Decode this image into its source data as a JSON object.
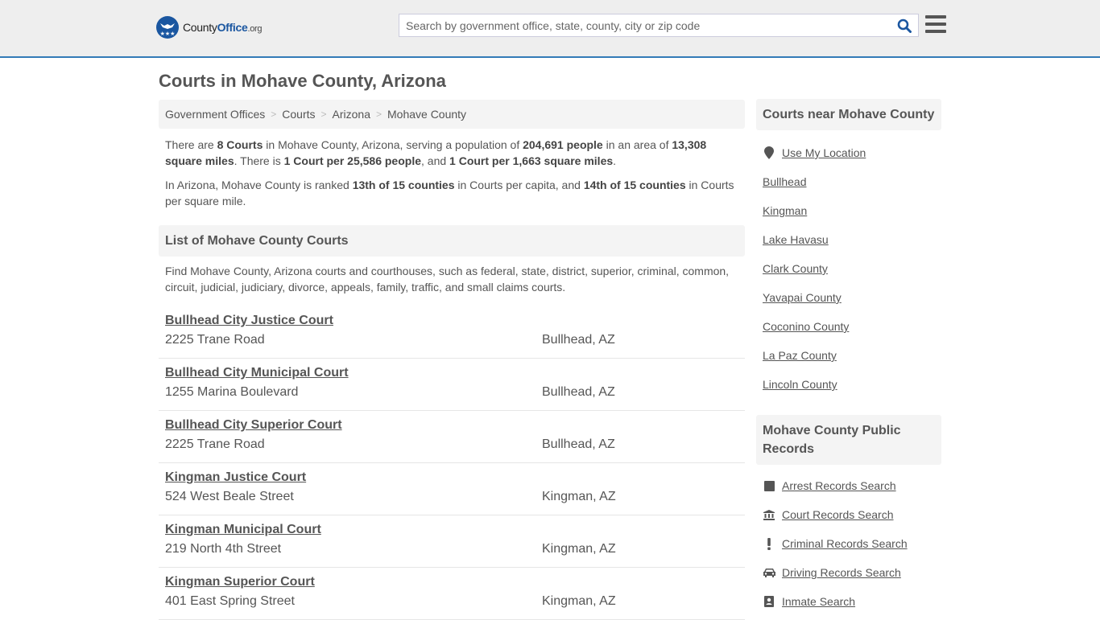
{
  "header": {
    "logo": {
      "name_part1": "County",
      "name_part2": "Office",
      "name_part3": ".org"
    },
    "search": {
      "placeholder": "Search by government office, state, county, city or zip code",
      "value": ""
    },
    "accent_color": "#337ab7",
    "logo_color": "#1a56a0"
  },
  "page": {
    "title": "Courts in Mohave County, Arizona"
  },
  "breadcrumb": [
    {
      "label": "Government Offices"
    },
    {
      "label": "Courts"
    },
    {
      "label": "Arizona"
    },
    {
      "label": "Mohave County"
    }
  ],
  "breadcrumb_separator": ">",
  "summary": {
    "p1": {
      "t1": "There are ",
      "b1": "8 Courts",
      "t2": " in Mohave County, Arizona, serving a population of ",
      "b2": "204,691 people",
      "t3": " in an area of ",
      "b3": "13,308 square miles",
      "t4": ". There is ",
      "b4": "1 Court per 25,586 people",
      "t5": ", and ",
      "b5": "1 Court per 1,663 square miles",
      "t6": "."
    },
    "p2": {
      "t1": "In Arizona, Mohave County is ranked ",
      "b1": "13th of 15 counties",
      "t2": " in Courts per capita, and ",
      "b2": "14th of 15 counties",
      "t3": " in Courts per square mile."
    }
  },
  "list_section": {
    "heading": "List of Mohave County Courts",
    "description": "Find Mohave County, Arizona courts and courthouses, such as federal, state, district, superior, criminal, common, circuit, judicial, judiciary, divorce, appeals, family, traffic, and small claims courts."
  },
  "courts": [
    {
      "name": "Bullhead City Justice Court",
      "address": "2225 Trane Road",
      "city": "Bullhead, AZ"
    },
    {
      "name": "Bullhead City Municipal Court",
      "address": "1255 Marina Boulevard",
      "city": "Bullhead, AZ"
    },
    {
      "name": "Bullhead City Superior Court",
      "address": "2225 Trane Road",
      "city": "Bullhead, AZ"
    },
    {
      "name": "Kingman Justice Court",
      "address": "524 West Beale Street",
      "city": "Kingman, AZ"
    },
    {
      "name": "Kingman Municipal Court",
      "address": "219 North 4th Street",
      "city": "Kingman, AZ"
    },
    {
      "name": "Kingman Superior Court",
      "address": "401 East Spring Street",
      "city": "Kingman, AZ"
    }
  ],
  "sidebar": {
    "near": {
      "heading": "Courts near Mohave County",
      "use_location": {
        "label": "Use My Location",
        "icon": "map-marker-icon"
      },
      "links": [
        {
          "label": "Bullhead"
        },
        {
          "label": "Kingman"
        },
        {
          "label": "Lake Havasu"
        },
        {
          "label": "Clark County"
        },
        {
          "label": "Yavapai County"
        },
        {
          "label": "Coconino County"
        },
        {
          "label": "La Paz County"
        },
        {
          "label": "Lincoln County"
        }
      ]
    },
    "records": {
      "heading": "Mohave County Public Records",
      "links": [
        {
          "label": "Arrest Records Search",
          "icon": "square-icon"
        },
        {
          "label": "Court Records Search",
          "icon": "courthouse-icon"
        },
        {
          "label": "Criminal Records Search",
          "icon": "exclamation-icon"
        },
        {
          "label": "Driving Records Search",
          "icon": "car-icon"
        },
        {
          "label": "Inmate Search",
          "icon": "id-badge-icon"
        }
      ]
    }
  }
}
